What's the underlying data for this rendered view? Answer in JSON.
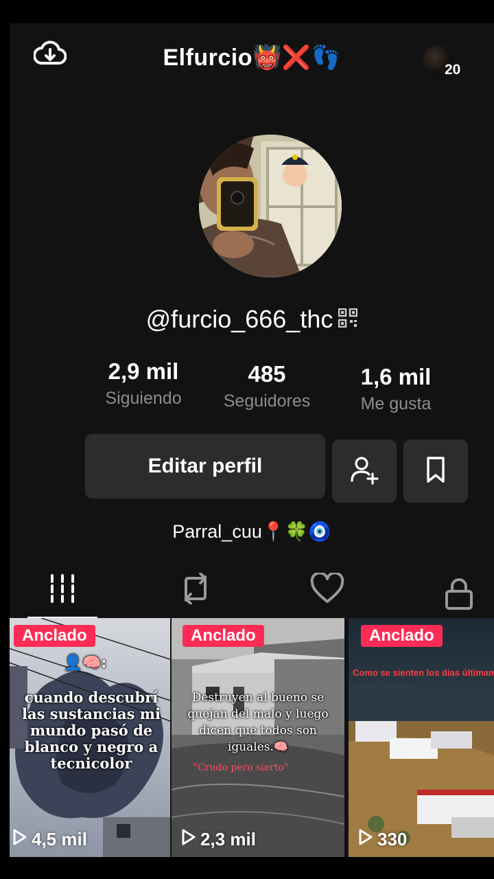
{
  "header": {
    "title": "Elfurcio👹❌👣",
    "download_icon": "cloud-download-icon",
    "friends_count": "20"
  },
  "profile": {
    "username": "@furcio_666_thc",
    "qr_icon": "qr-code-icon",
    "bio": "Parral_cuu📍🍀🧿"
  },
  "stats": [
    {
      "value": "2,9 mil",
      "label": "Siguiendo"
    },
    {
      "value": "485",
      "label": "Seguidores"
    },
    {
      "value": "1,6 mil",
      "label": "Me gusta"
    }
  ],
  "actions": {
    "edit_label": "Editar perfil",
    "add_friend_icon": "add-user-icon",
    "favorites_icon": "bookmark-icon"
  },
  "tabs": [
    {
      "icon": "grid-icon",
      "active": true
    },
    {
      "icon": "repost-icon",
      "active": false
    },
    {
      "icon": "heart-icon",
      "active": false
    },
    {
      "icon": "lock-icon",
      "active": false
    }
  ],
  "videos": [
    {
      "pinned_label": "Anclado",
      "caption_top": "👤🧠:",
      "caption": "cuando descubrí las sustancias mi mundo pasó de blanco y negro a tecnicolor",
      "views": "4,5 mil"
    },
    {
      "pinned_label": "Anclado",
      "caption": "Destruyen al bueno se quejan del malo y luego dicen que todos son iguales.🧠",
      "caption_red": "\"Crudo pero sierto\"",
      "views": "2,3 mil"
    },
    {
      "pinned_label": "Anclado",
      "caption_red": "Como se sienten los días últimame",
      "views": "330"
    }
  ],
  "colors": {
    "background": "#121212",
    "button": "#2c2c2c",
    "accent": "#fe2c55",
    "muted": "#8d8d8d"
  }
}
